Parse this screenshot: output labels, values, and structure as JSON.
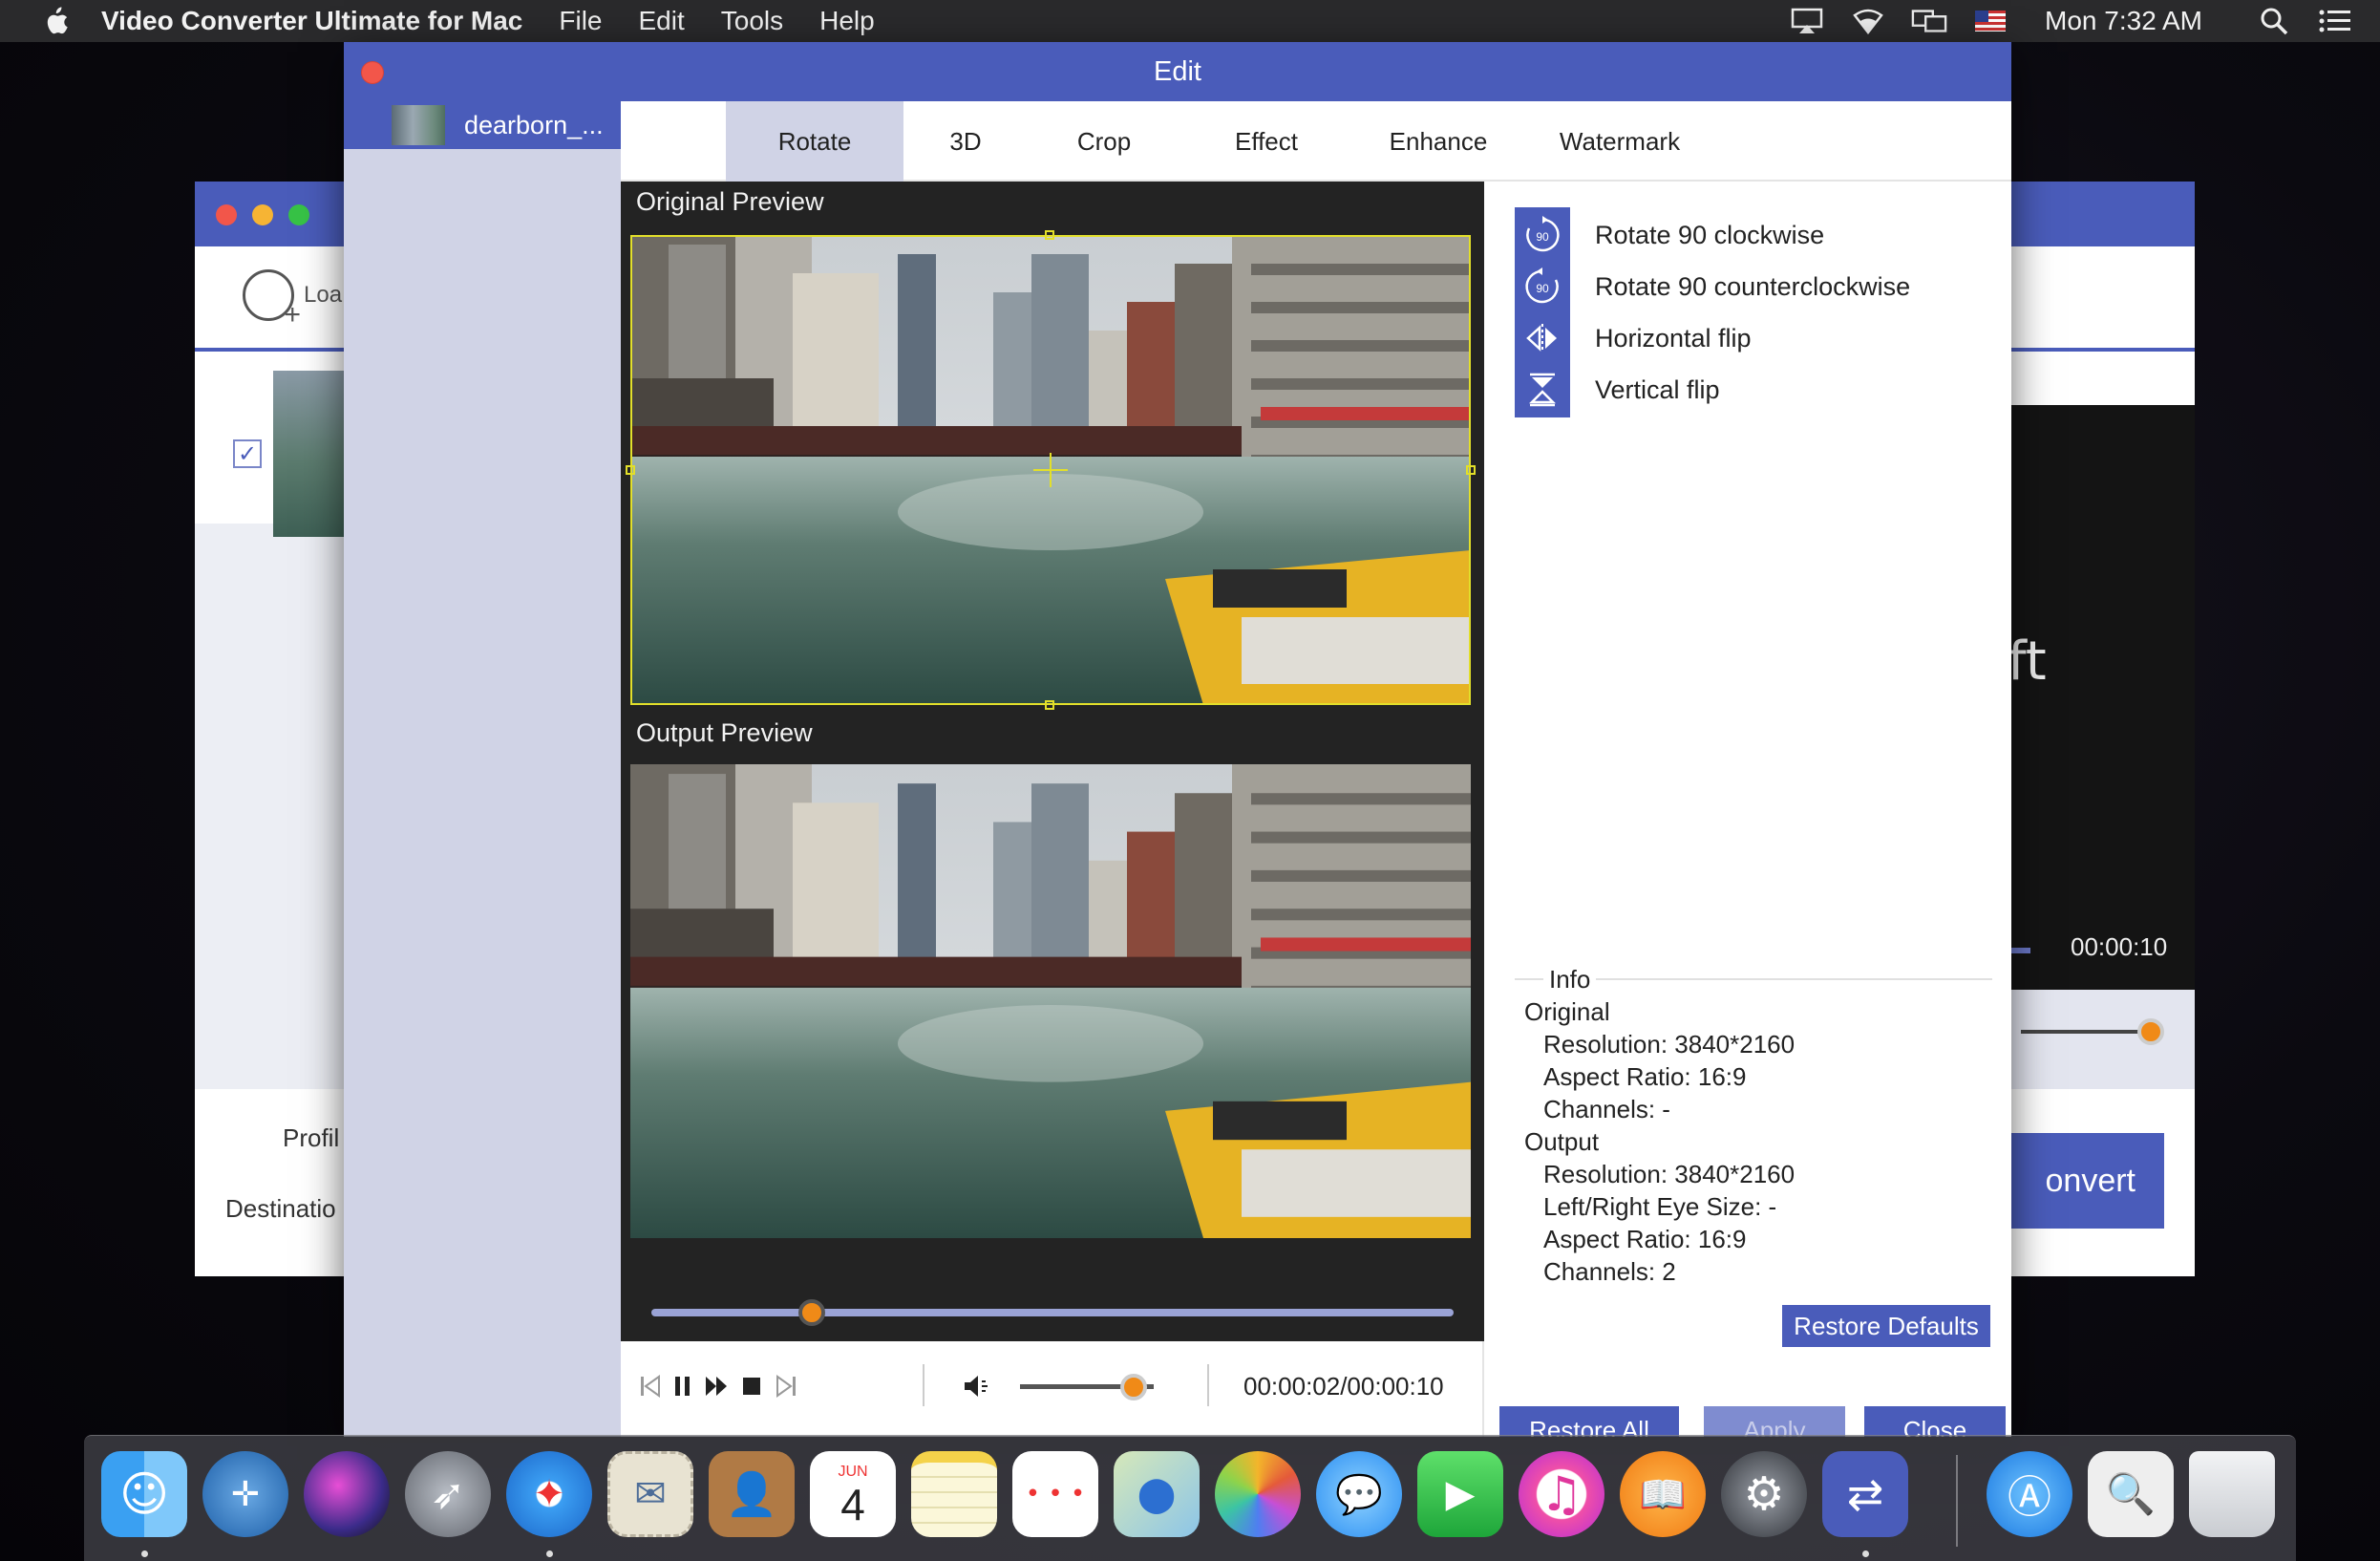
{
  "menubar": {
    "app_name": "Video Converter Ultimate for Mac",
    "menus": [
      "File",
      "Edit",
      "Tools",
      "Help"
    ],
    "clock": "Mon 7:32 AM",
    "status_icons": [
      "airplay-icon",
      "wifi-icon",
      "display-icon",
      "us-flag-icon",
      "spotlight-icon",
      "notification-center-icon"
    ]
  },
  "main_window": {
    "load_label": "Loa",
    "profile_label": "Profil",
    "destination_label": "Destinatio",
    "player_text": "ft",
    "player_time": "00:00:10",
    "convert_label": "onvert",
    "file_checked": true
  },
  "edit_window": {
    "title": "Edit",
    "sidebar_file": "dearborn_...",
    "tabs": [
      "Rotate",
      "3D",
      "Crop",
      "Effect",
      "Enhance",
      "Watermark"
    ],
    "active_tab": "Rotate",
    "original_preview_label": "Original Preview",
    "output_preview_label": "Output Preview",
    "time_readout": "00:00:02/00:00:10",
    "seek_fraction": 0.2,
    "volume_fraction": 0.85,
    "rotate_options": [
      {
        "icon": "rotate-clockwise-icon",
        "label": "Rotate 90 clockwise"
      },
      {
        "icon": "rotate-counterclockwise-icon",
        "label": "Rotate 90 counterclockwise"
      },
      {
        "icon": "horizontal-flip-icon",
        "label": "Horizontal flip"
      },
      {
        "icon": "vertical-flip-icon",
        "label": "Vertical flip"
      }
    ],
    "info": {
      "title": "Info",
      "original_heading": "Original",
      "original_resolution": "Resolution: 3840*2160",
      "original_aspect": "Aspect Ratio: 16:9",
      "original_channels": "Channels: -",
      "output_heading": "Output",
      "output_resolution": "Resolution: 3840*2160",
      "output_eye_size": "Left/Right Eye Size: -",
      "output_aspect": "Aspect Ratio: 16:9",
      "output_channels": "Channels: 2"
    },
    "restore_defaults_label": "Restore Defaults",
    "restore_all_label": "Restore All",
    "apply_label": "Apply",
    "close_label": "Close"
  },
  "dock": {
    "calendar_month": "JUN",
    "calendar_day": "4",
    "apps": [
      "finder-icon",
      "network-radar-icon",
      "siri-icon",
      "launchpad-icon",
      "safari-icon",
      "mail-stamp-icon",
      "contacts-icon",
      "calendar-icon",
      "notes-icon",
      "reminders-icon",
      "maps-icon",
      "photos-icon",
      "messages-icon",
      "facetime-icon",
      "itunes-icon",
      "ibooks-icon",
      "system-preferences-icon",
      "video-converter-icon",
      "app-store-icon",
      "preview-icon",
      "trash-icon"
    ]
  },
  "colors": {
    "accent": "#4a5cba",
    "knob": "#f08a17",
    "selection": "#e2df2a"
  }
}
